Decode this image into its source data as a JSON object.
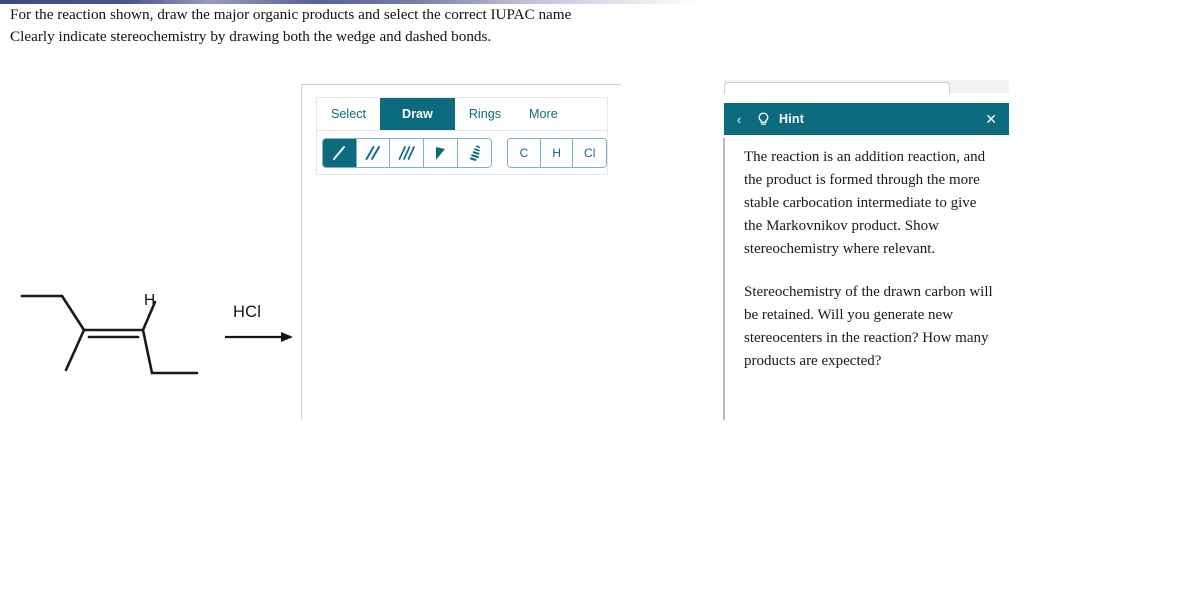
{
  "prompt": {
    "line1": "For the reaction shown, draw the major organic products and select the correct IUPAC name",
    "line2": "Clearly indicate stereochemistry by drawing both the wedge and dashed bonds."
  },
  "reaction": {
    "reagent_label": "HCl",
    "substituent_label": "H",
    "structure_name": "3-methylhex-3-ene"
  },
  "editor": {
    "tabs": [
      {
        "label": "Select",
        "active": false
      },
      {
        "label": "Draw",
        "active": true
      },
      {
        "label": "Rings",
        "active": false
      },
      {
        "label": "More",
        "active": false
      }
    ],
    "bond_tools": [
      {
        "name": "single-bond",
        "active": true
      },
      {
        "name": "double-bond",
        "active": false
      },
      {
        "name": "triple-bond",
        "active": false
      },
      {
        "name": "wedge-bond",
        "active": false
      },
      {
        "name": "hash-bond",
        "active": false
      }
    ],
    "element_tools": [
      {
        "label": "C"
      },
      {
        "label": "H"
      },
      {
        "label": "Cl"
      }
    ]
  },
  "hint": {
    "back_glyph": "‹",
    "title": "Hint",
    "close_glyph": "✕",
    "paragraph1": "The reaction is an addition reaction, and the product is formed through the more stable carbocation intermediate to give the Markovnikov product. Show stereochemistry where relevant.",
    "paragraph2": "Stereochemistry of the drawn carbon will be retained. Will you generate new stereocenters in the reaction? How many products are expected?"
  },
  "colors": {
    "accent_teal": "#0d6b80",
    "tool_border": "#7fb3c0",
    "panel_border": "#d2d2d2",
    "text": "#111214"
  }
}
